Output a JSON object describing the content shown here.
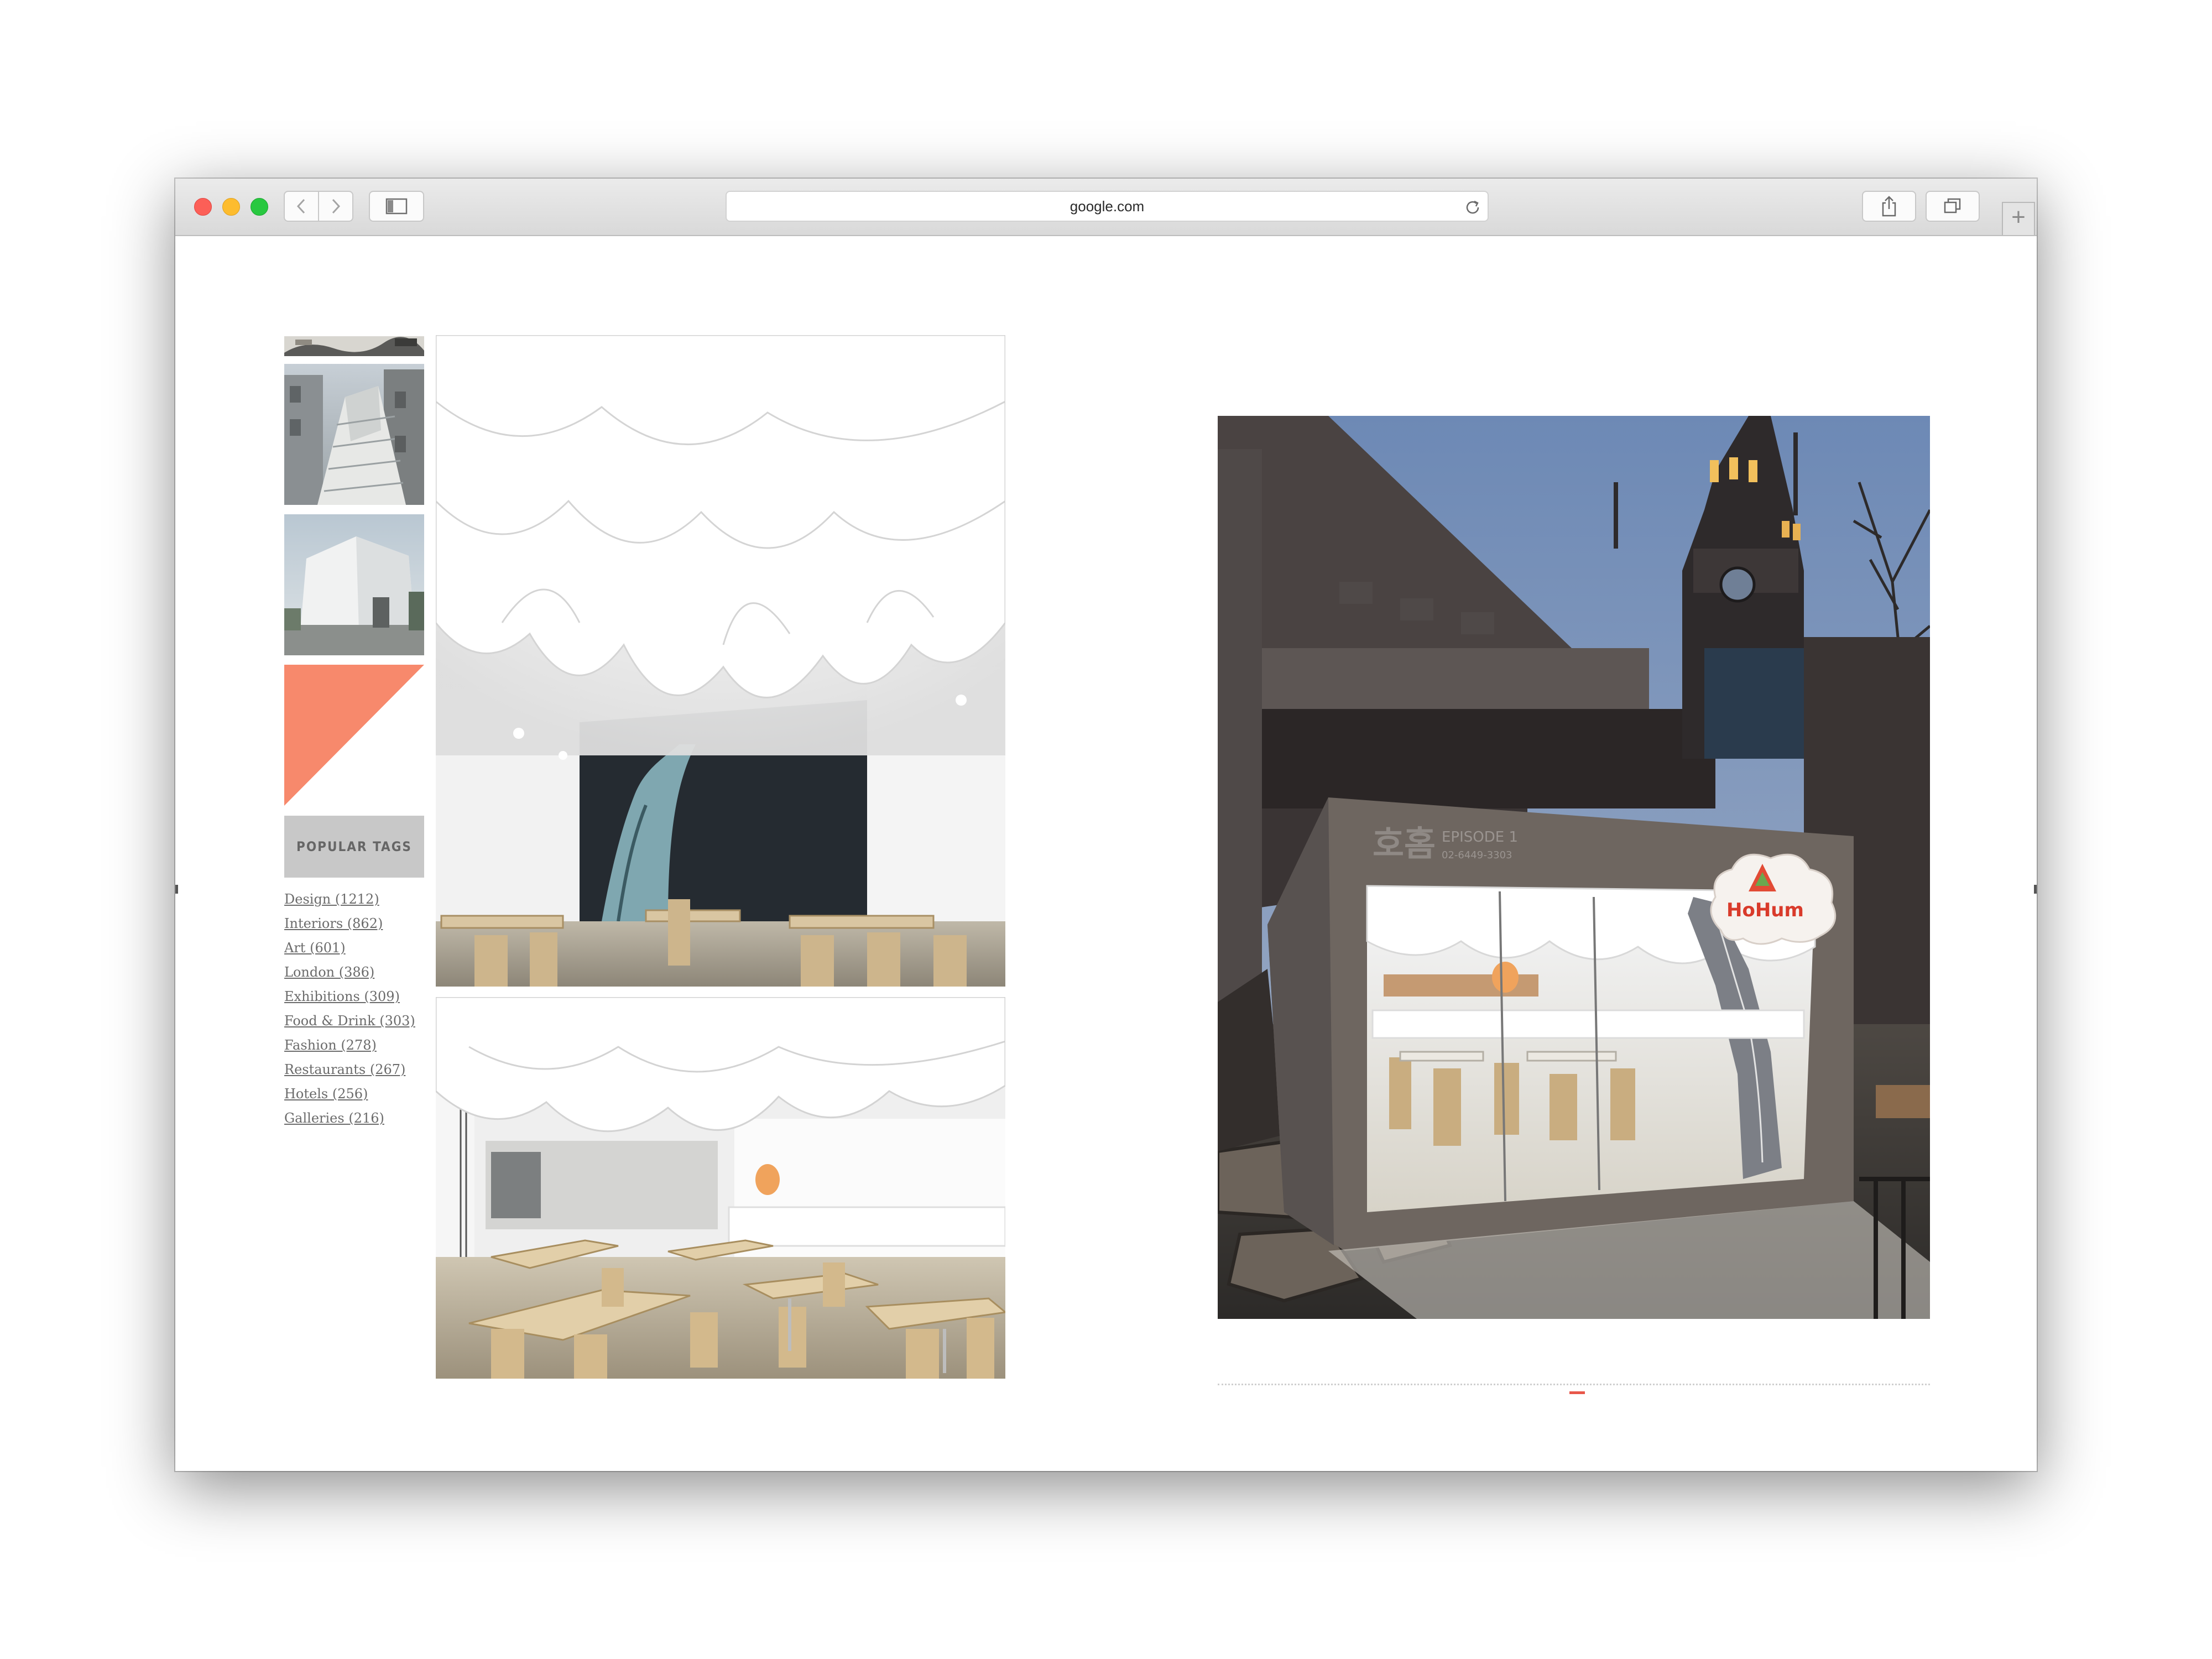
{
  "browser": {
    "address": "google.com",
    "back_icon": "chevron-left-icon",
    "forward_icon": "chevron-right-icon",
    "sidebar_icon": "sidebar-icon",
    "reload_icon": "reload-icon",
    "share_icon": "share-icon",
    "tabs_icon": "tabs-overview-icon",
    "new_tab_label": "+"
  },
  "sidebar": {
    "popular_tags_label": "POPULAR TAGS",
    "accent_color": "#f7896c",
    "tags": [
      {
        "label": "Design (1212)"
      },
      {
        "label": "Interiors (862)"
      },
      {
        "label": "Art (601)"
      },
      {
        "label": "London (386)"
      },
      {
        "label": "Exhibitions (309)"
      },
      {
        "label": "Food & Drink (303)"
      },
      {
        "label": "Fashion (278)"
      },
      {
        "label": "Restaurants (267)"
      },
      {
        "label": "Hotels (256)"
      },
      {
        "label": "Galleries (216)"
      }
    ]
  },
  "storefront": {
    "korean_sign": "호홈",
    "episode_label": "EPISODE 1",
    "phone": "02-6449-3303",
    "logo_text": "HoHum"
  }
}
